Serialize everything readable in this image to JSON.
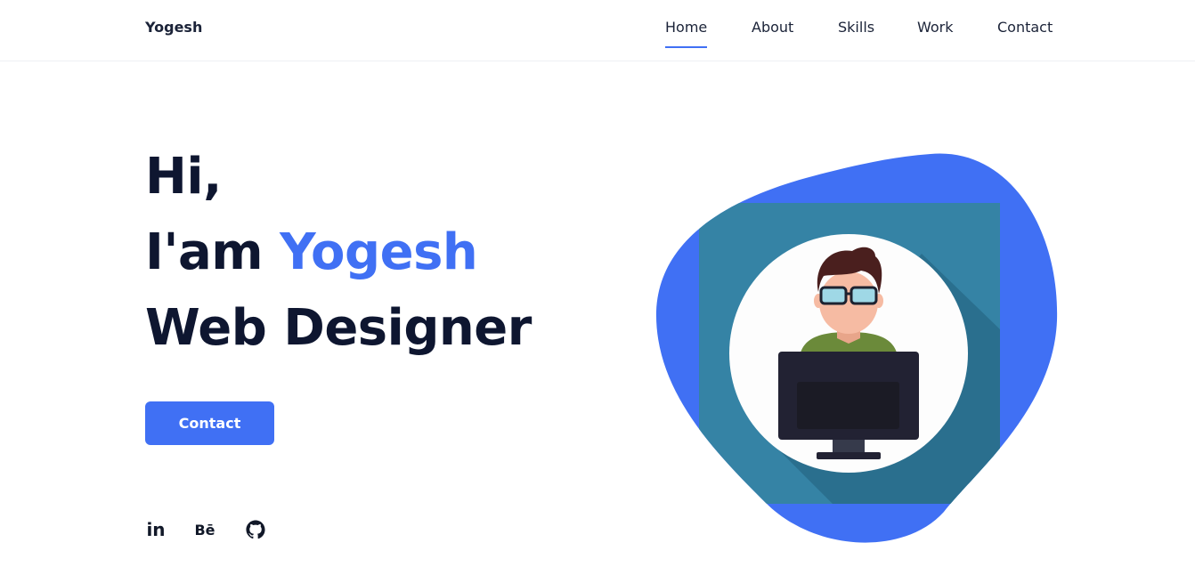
{
  "header": {
    "logo": "Yogesh",
    "nav": [
      {
        "label": "Home",
        "active": true
      },
      {
        "label": "About",
        "active": false
      },
      {
        "label": "Skills",
        "active": false
      },
      {
        "label": "Work",
        "active": false
      },
      {
        "label": "Contact",
        "active": false
      }
    ]
  },
  "hero": {
    "line1": "Hi,",
    "line2_prefix": "I'am ",
    "line2_name": "Yogesh",
    "line3": "Web Designer",
    "cta_label": "Contact"
  },
  "social": [
    {
      "icon": "linkedin-icon",
      "glyph": "in"
    },
    {
      "icon": "behance-icon",
      "glyph": "Bē"
    },
    {
      "icon": "github-icon",
      "glyph": ""
    }
  ],
  "colors": {
    "accent": "#4070f4",
    "text": "#0e1630",
    "blob": "#4070f4",
    "square": "#3583a5",
    "shadow": "#2a6f8e"
  }
}
